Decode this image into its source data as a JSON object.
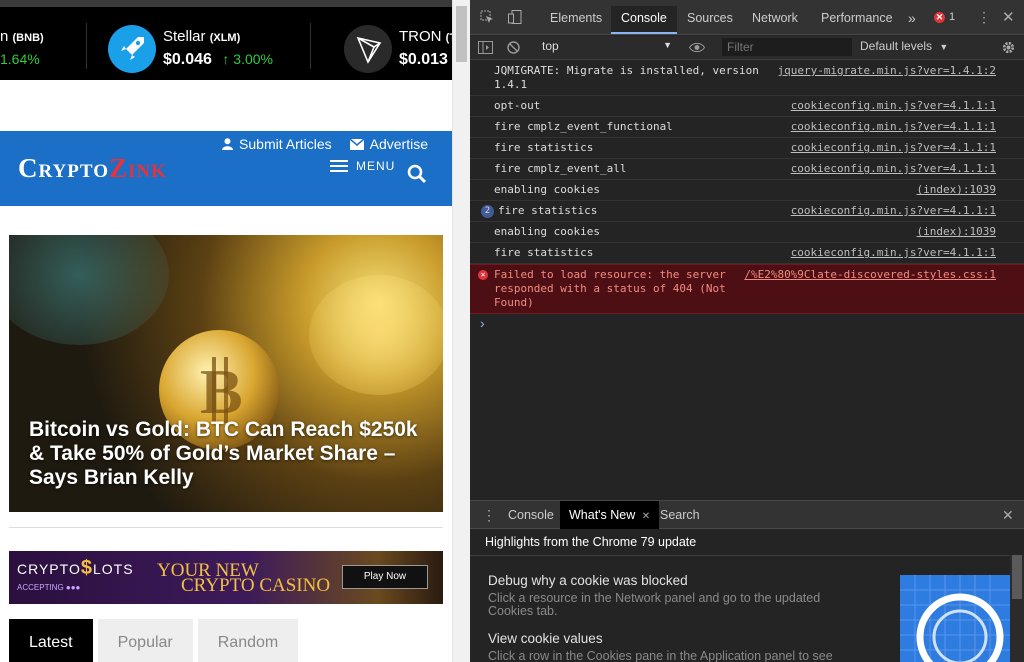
{
  "ticker": {
    "coins": [
      {
        "name": "n",
        "symbol": "(BNB)",
        "price": "",
        "change": "1.64%"
      },
      {
        "name": "Stellar",
        "symbol": "(XLM)",
        "price": "$0.046",
        "change": "3.00%"
      },
      {
        "name": "TRON",
        "symbol": "(T",
        "price": "$0.013",
        "change": ""
      }
    ]
  },
  "header": {
    "submit_label": "Submit Articles",
    "advertise_label": "Advertise",
    "logo_part1": "Crypto",
    "logo_part2": "Zink",
    "menu_label": "MENU"
  },
  "hero": {
    "headline": "Bitcoin vs Gold: BTC Can Reach $250k & Take 50% of Gold’s Market Share – Says Brian Kelly"
  },
  "banner": {
    "brand_a": "CRYPTO",
    "brand_b": "$",
    "brand_c": "LOTS",
    "accepting": "ACCEPTING",
    "tagline1": "YOUR NEW",
    "tagline2": "CRYPTO CASINO",
    "cta": "Play Now"
  },
  "post_tabs": [
    "Latest",
    "Popular",
    "Random"
  ],
  "devtools": {
    "tabs": [
      "Elements",
      "Console",
      "Sources",
      "Network",
      "Performance"
    ],
    "more": "»",
    "error_count": "1",
    "context": "top",
    "filter_placeholder": "Filter",
    "levels": "Default levels",
    "messages": [
      {
        "text": "JQMIGRATE: Migrate is installed, version 1.4.1",
        "source": "jquery-migrate.min.js?ver=1.4.1:2",
        "count": "",
        "level": "log"
      },
      {
        "text": "opt-out",
        "source": "cookieconfig.min.js?ver=4.1.1:1",
        "count": "",
        "level": "log"
      },
      {
        "text": "fire cmplz_event_functional",
        "source": "cookieconfig.min.js?ver=4.1.1:1",
        "count": "",
        "level": "log"
      },
      {
        "text": "fire statistics",
        "source": "cookieconfig.min.js?ver=4.1.1:1",
        "count": "",
        "level": "log"
      },
      {
        "text": "fire cmplz_event_all",
        "source": "cookieconfig.min.js?ver=4.1.1:1",
        "count": "",
        "level": "log"
      },
      {
        "text": "enabling cookies",
        "source": "(index):1039",
        "count": "",
        "level": "log"
      },
      {
        "text": "fire statistics",
        "source": "cookieconfig.min.js?ver=4.1.1:1",
        "count": "2",
        "level": "log"
      },
      {
        "text": "enabling cookies",
        "source": "(index):1039",
        "count": "",
        "level": "log"
      },
      {
        "text": "fire statistics",
        "source": "cookieconfig.min.js?ver=4.1.1:1",
        "count": "",
        "level": "log"
      },
      {
        "text": "Failed to load resource: the server responded with a status of 404 (Not Found)",
        "source": "/%E2%80%9Clate-discovered-styles.css:1",
        "count": "",
        "level": "error"
      }
    ],
    "drawer": {
      "tabs": [
        "Console",
        "What's New",
        "Search"
      ],
      "title": "Highlights from the Chrome 79 update",
      "items": [
        {
          "heading": "Debug why a cookie was blocked",
          "body": "Click a resource in the Network panel and go to the updated Cookies tab."
        },
        {
          "heading": "View cookie values",
          "body": "Click a row in the Cookies pane in the Application panel to see"
        }
      ]
    }
  },
  "colors": {
    "site_header": "#1b6fc6",
    "logo_accent": "#e8313a",
    "ticker_up": "#2ecc40",
    "devtools_error_bg": "#4e0f14",
    "devtools_error_text": "#f28b82"
  }
}
